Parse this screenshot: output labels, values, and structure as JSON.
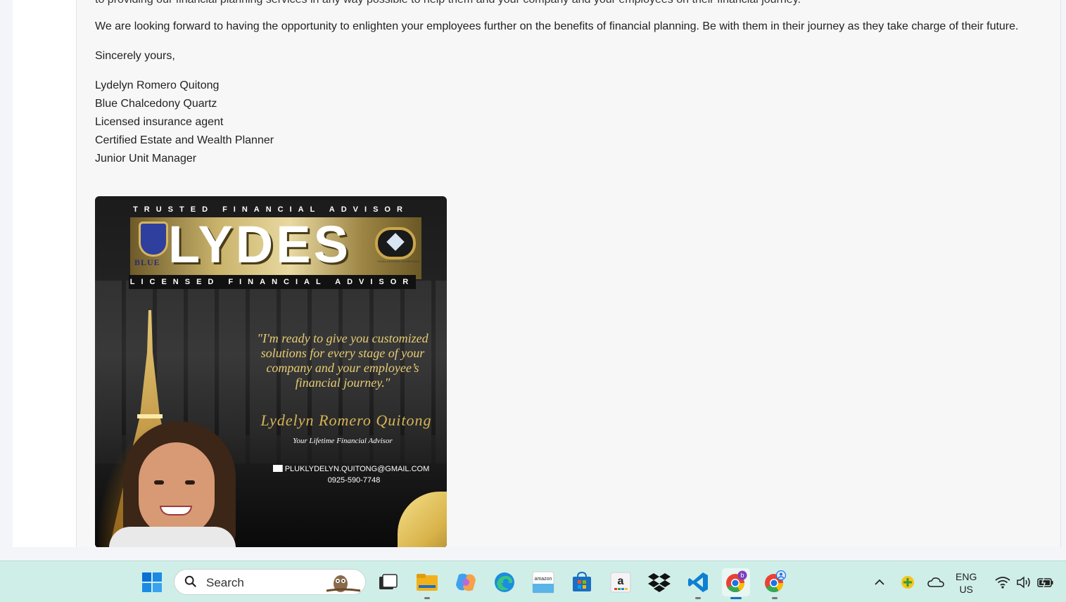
{
  "email": {
    "cut_line": "to providing our financial planning services in any way possible to help them and your company and your employees on their financial journey.",
    "paragraph": "We are looking forward to having the opportunity to enlighten your employees further on the benefits of financial planning. Be with them in their journey as they take charge of their future.",
    "closing": "Sincerely yours,",
    "signature": [
      "Lydelyn Romero Quitong",
      "Blue Chalcedony Quartz",
      "Licensed insurance agent",
      "Certified Estate and Wealth Planner",
      "Junior Unit Manager"
    ]
  },
  "banner": {
    "top_caption": "TRUSTED FINANCIAL ADVISOR",
    "brand": "LYDES",
    "shield_text": "BLUE",
    "gem_text": "CHALCEDONY DIAMONDS",
    "sub_caption": "LICENSED FINANCIAL ADVISOR",
    "quote": "\"I'm ready to give you customized solutions for every stage of your company and your employee’s financial journey.\"",
    "signature": "Lydelyn Romero Quitong",
    "tagline": "Your Lifetime Financial Advisor",
    "email": "PLUKLYDELYN.QUITONG@GMAIL.COM",
    "phone": "0925-590-7748"
  },
  "taskbar": {
    "search_placeholder": "Search",
    "apps": [
      "start-icon",
      "search-icon",
      "task-view-icon",
      "file-explorer-icon",
      "copilot-icon",
      "edge-icon",
      "amazon-shopping-icon",
      "microsoft-store-icon",
      "amazon-icon",
      "dropbox-icon",
      "vscode-icon",
      "chrome-icon",
      "chrome-profile-icon"
    ],
    "language": "ENG",
    "region": "US"
  },
  "colors": {
    "taskbar_bg": "#cfeee7",
    "gold": "#e7cc73",
    "accent": "#1b6ec2"
  }
}
